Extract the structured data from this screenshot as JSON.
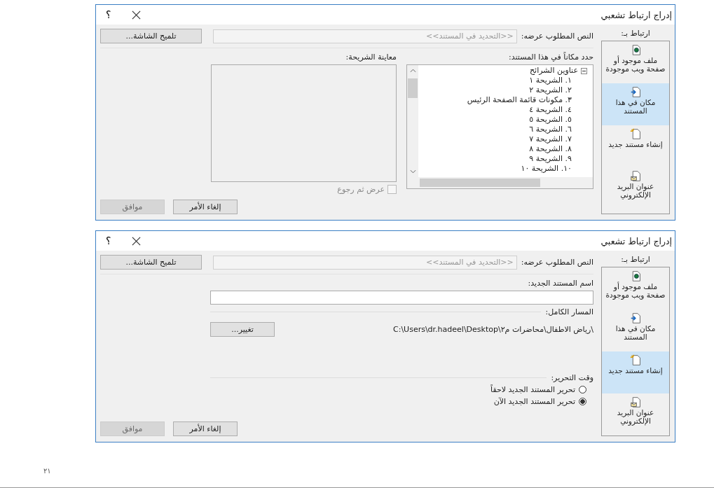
{
  "dialogs": [
    {
      "kind": "place",
      "title": "إدراج ارتباط تشعبي",
      "help": "؟",
      "link_to_label": "ارتباط بـ:",
      "link_targets": [
        {
          "label": "ملف موجود أو صفحة ويب موجودة",
          "selected": false
        },
        {
          "label": "مكان في هذا المستند",
          "selected": true
        },
        {
          "label": "إنشاء مستند جديد",
          "selected": false
        },
        {
          "label": "عنوان البريد الإلكتروني",
          "selected": false
        }
      ],
      "display_text": {
        "label": "النص المطلوب عرضه:",
        "value": "<<التحديد في المستند>>"
      },
      "screen_tip_button": "تلميح الشاشة...",
      "ok_button": {
        "label": "موافق",
        "disabled": true
      },
      "cancel_button": "إلغاء الأمر",
      "place": {
        "tree_label": "حدد مكاناً في هذا المستند:",
        "tree": [
          {
            "label": "عناوين الشرائح",
            "expanded": true,
            "children": [
              {
                "label": "١. الشريحة ١"
              },
              {
                "label": "٢. الشريحة ٢"
              },
              {
                "label": "٣. مكونات قائمة الصفحة الرئيس"
              },
              {
                "label": "٤. الشريحة ٤"
              },
              {
                "label": "٥. الشريحة ٥"
              },
              {
                "label": "٦. الشريحة ٦"
              },
              {
                "label": "٧. الشريحة ٧"
              },
              {
                "label": "٨. الشريحة ٨"
              },
              {
                "label": "٩. الشريحة ٩"
              },
              {
                "label": "١٠. الشريحة ١٠"
              }
            ]
          }
        ],
        "preview_label": "معاينة الشريحة:",
        "show_and_return": {
          "label": "عرض ثم رجوع",
          "checked": false,
          "disabled": true
        }
      }
    },
    {
      "kind": "new_document",
      "title": "إدراج ارتباط تشعبي",
      "help": "؟",
      "link_to_label": "ارتباط بـ:",
      "link_targets": [
        {
          "label": "ملف موجود أو صفحة ويب موجودة",
          "selected": false
        },
        {
          "label": "مكان في هذا المستند",
          "selected": false
        },
        {
          "label": "إنشاء مستند جديد",
          "selected": true
        },
        {
          "label": "عنوان البريد الإلكتروني",
          "selected": false
        }
      ],
      "display_text": {
        "label": "النص المطلوب عرضه:",
        "value": "<<التحديد في المستند>>"
      },
      "screen_tip_button": "تلميح الشاشة...",
      "ok_button": {
        "label": "موافق",
        "disabled": true
      },
      "cancel_button": "إلغاء الأمر",
      "new_document": {
        "name_label": "اسم المستند الجديد:",
        "path_label": "المسار الكامل:",
        "path": "C:\\Users\\dr.hadeel\\Desktop\\رياض الاطفال\\محاضرات م٢\\",
        "change_button": "تغيير...",
        "when_label": "وقت التحرير:",
        "edit_options": [
          {
            "label": "تحرير المستند الجديد لاحقاً",
            "selected": false
          },
          {
            "label": "تحرير المستند الجديد الآن",
            "selected": true
          }
        ]
      }
    }
  ],
  "page_number": "٢١"
}
